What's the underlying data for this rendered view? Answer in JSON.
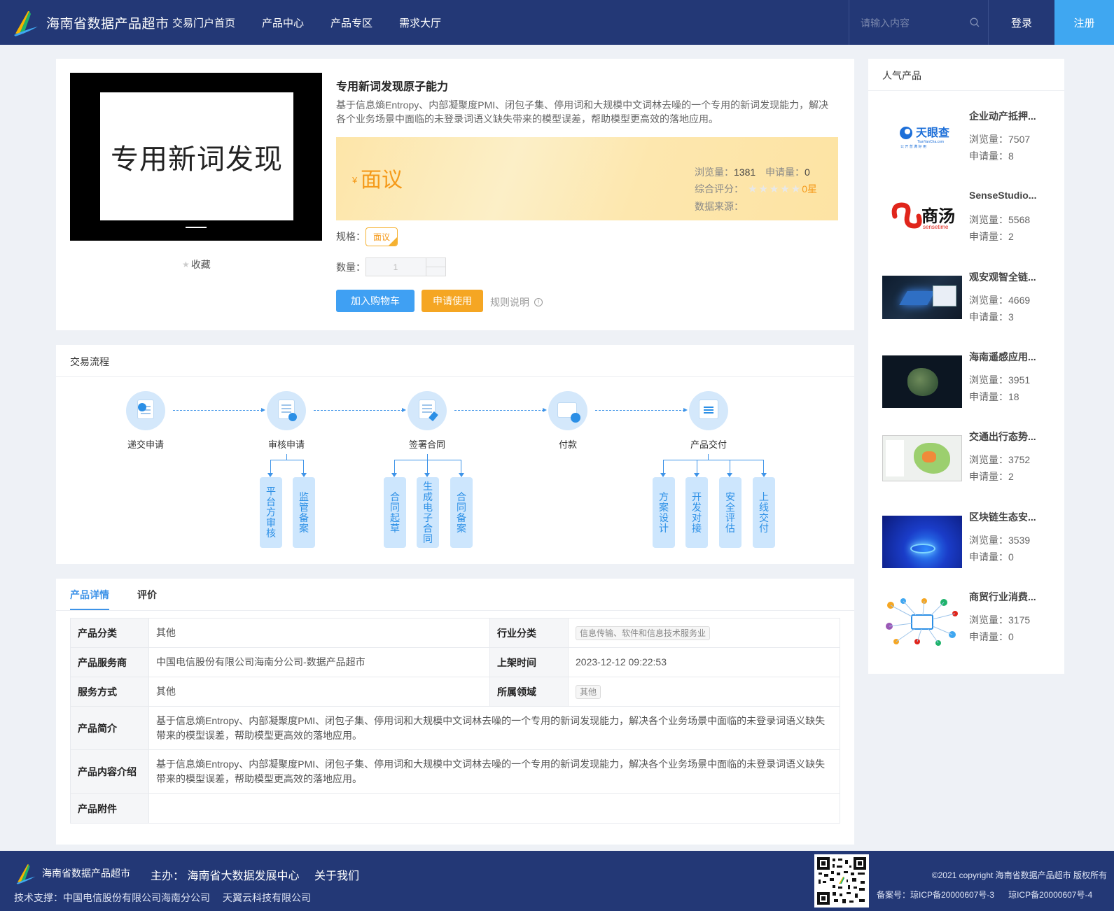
{
  "header": {
    "site_title": "海南省数据产品超市",
    "nav": [
      "交易门户首页",
      "产品中心",
      "产品专区",
      "需求大厅"
    ],
    "search_placeholder": "请输入内容",
    "login": "登录",
    "register": "注册"
  },
  "product": {
    "image_text": "专用新词发现",
    "favorite": "收藏",
    "title": "专用新词发现原子能力",
    "description": "基于信息熵Entropy、内部凝聚度PMI、闭包子集、停用词和大规模中文词林去噪的一个专用的新词发现能力，解决各个业务场景中面临的未登录词语义缺失带来的模型误差，帮助模型更高效的落地应用。",
    "price_symbol": "¥",
    "price": "面议",
    "views_label": "浏览量：",
    "views": "1381",
    "apply_label": "申请量：",
    "applies": "0",
    "rating_label": "综合评分：",
    "rating_stars": "★★★★★",
    "rating_value": "0星",
    "source_label": "数据来源：",
    "spec_label": "规格：",
    "spec_value": "面议",
    "qty_label": "数量：",
    "qty_value": "1",
    "add_cart": "加入购物车",
    "apply_use": "申请使用",
    "rules": "规则说明",
    "info_glyph": "!"
  },
  "process": {
    "title": "交易流程",
    "steps": [
      "递交申请",
      "审核申请",
      "签署合同",
      "付款",
      "产品交付"
    ],
    "sub_review": [
      "平台方审核",
      "监管备案"
    ],
    "sub_contract": [
      "合同起草",
      "生成电子合同",
      "合同备案"
    ],
    "sub_delivery": [
      "方案设计",
      "开发对接",
      "安全评估",
      "上线交付"
    ]
  },
  "detail": {
    "tabs": [
      "产品详情",
      "评价"
    ],
    "rows": {
      "category_k": "产品分类",
      "category_v": "其他",
      "industry_k": "行业分类",
      "industry_v": "信息传输、软件和信息技术服务业",
      "provider_k": "产品服务商",
      "provider_v": "中国电信股份有限公司海南分公司-数据产品超市",
      "listed_k": "上架时间",
      "listed_v": "2023-12-12 09:22:53",
      "service_k": "服务方式",
      "service_v": "其他",
      "domain_k": "所属领域",
      "domain_v": "其他",
      "intro_k": "产品简介",
      "intro_v": "基于信息熵Entropy、内部凝聚度PMI、闭包子集、停用词和大规模中文词林去噪的一个专用的新词发现能力，解决各个业务场景中面临的未登录词语义缺失带来的模型误差，帮助模型更高效的落地应用。",
      "content_k": "产品内容介绍",
      "content_v": "基于信息熵Entropy、内部凝聚度PMI、闭包子集、停用词和大规模中文词林去噪的一个专用的新词发现能力，解决各个业务场景中面临的未登录词语义缺失带来的模型误差，帮助模型更高效的落地应用。",
      "attach_k": "产品附件",
      "attach_v": ""
    }
  },
  "popular": {
    "title": "人气产品",
    "views_label": "浏览量：",
    "apply_label": "申请量：",
    "thumb_tianyancha": "天眼查",
    "thumb_tianyancha_sub": "TianYanCha.com",
    "thumb_tianyancha_tag": "公 开 普 满 好 用",
    "thumb_sensetime": "商汤",
    "thumb_sensetime_sub": "sensetime",
    "items": [
      {
        "name": "企业动产抵押...",
        "views": "7507",
        "applies": "8"
      },
      {
        "name": "SenseStudio...",
        "views": "5568",
        "applies": "2"
      },
      {
        "name": "观安观智全链...",
        "views": "4669",
        "applies": "3"
      },
      {
        "name": "海南遥感应用...",
        "views": "3951",
        "applies": "18"
      },
      {
        "name": "交通出行态势...",
        "views": "3752",
        "applies": "2"
      },
      {
        "name": "区块链生态安...",
        "views": "3539",
        "applies": "0"
      },
      {
        "name": "商贸行业消费...",
        "views": "3175",
        "applies": "0"
      }
    ]
  },
  "footer": {
    "site_name": "海南省数据产品超市",
    "host": "主办： 海南省大数据发展中心",
    "about": "关于我们",
    "support": "技术支撑：中国电信股份有限公司海南分公司",
    "support2": "天翼云科技有限公司",
    "copyright": "©2021 copyright 海南省数据产品超市 版权所有",
    "icp1": "备案号：琼ICP备20000607号-3",
    "icp2": "琼ICP备20000607号-4"
  },
  "colors": {
    "header_bg": "#233876",
    "accent_blue": "#3fa0f3",
    "accent_orange": "#f5a623"
  }
}
